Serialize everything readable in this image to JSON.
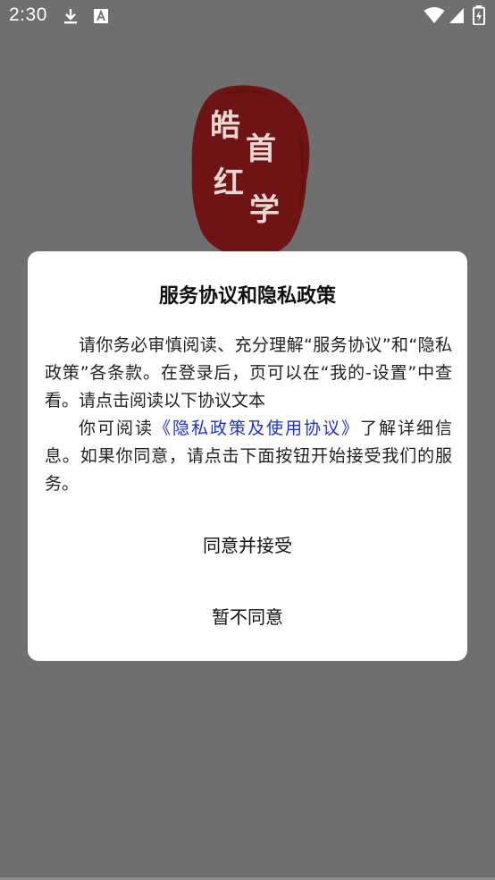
{
  "status_bar": {
    "time": "2:30",
    "icons": [
      "download-icon",
      "notification-a-icon",
      "wifi-icon",
      "signal-icon",
      "battery-icon"
    ]
  },
  "logo": {
    "chars": [
      "皓",
      "首",
      "红",
      "学"
    ],
    "seal_color": "#6f1414"
  },
  "dialog": {
    "title": "服务协议和隐私政策",
    "paragraph1": "请你务必审慎阅读、充分理解“服务协议”和“隐私政策”各条款。在登录后，页可以在“我的-设置”中查看。请点击阅读以下协议文本",
    "paragraph2_prefix": "你可阅读",
    "policy_link": "《隐私政策及使用协议》",
    "paragraph2_suffix": "了解详细信息。如果你同意，请点击下面按钮开始接受我们的服务。",
    "accept_label": "同意并接受",
    "decline_label": "暂不同意"
  },
  "colors": {
    "overlay": "#6f6f6f",
    "link": "#1f32c8",
    "dialog_bg": "#ffffff"
  }
}
